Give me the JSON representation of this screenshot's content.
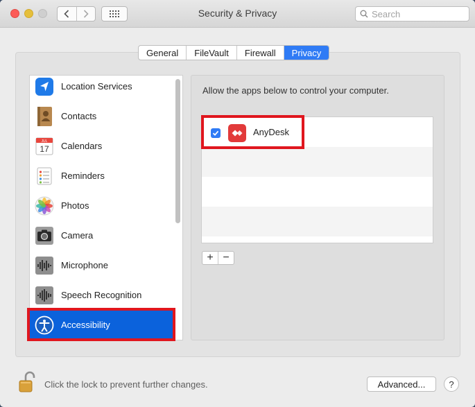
{
  "window": {
    "title": "Security & Privacy"
  },
  "toolbar": {
    "back_icon": "chevron-left-icon",
    "forward_icon": "chevron-right-icon",
    "grid_icon": "grid-icon"
  },
  "search": {
    "placeholder": "Search",
    "icon": "search-icon"
  },
  "tabs": [
    {
      "label": "General",
      "active": false
    },
    {
      "label": "FileVault",
      "active": false
    },
    {
      "label": "Firewall",
      "active": false
    },
    {
      "label": "Privacy",
      "active": true
    }
  ],
  "sidebar": {
    "items": [
      {
        "label": "Location Services",
        "icon": "location-arrow-icon"
      },
      {
        "label": "Contacts",
        "icon": "contacts-book-icon"
      },
      {
        "label": "Calendars",
        "icon": "calendar-icon",
        "calendar_month": "JUL",
        "calendar_day": "17"
      },
      {
        "label": "Reminders",
        "icon": "reminders-list-icon"
      },
      {
        "label": "Photos",
        "icon": "photos-flower-icon"
      },
      {
        "label": "Camera",
        "icon": "camera-icon"
      },
      {
        "label": "Microphone",
        "icon": "microphone-waveform-icon"
      },
      {
        "label": "Speech Recognition",
        "icon": "speech-waveform-icon"
      },
      {
        "label": "Accessibility",
        "icon": "accessibility-icon",
        "selected": true
      }
    ]
  },
  "privacy": {
    "description": "Allow the apps below to control your computer.",
    "apps": [
      {
        "name": "AnyDesk",
        "checked": true,
        "icon": "anydesk-icon"
      }
    ],
    "add_label": "+",
    "remove_label": "−"
  },
  "footer": {
    "lock_text": "Click the lock to prevent further changes.",
    "lock_icon": "lock-open-icon",
    "advanced_label": "Advanced...",
    "help_label": "?"
  },
  "colors": {
    "accent": "#2f7bf5",
    "selection": "#0b62dc",
    "annotation": "#e0161e",
    "anydesk": "#e23a3a"
  }
}
